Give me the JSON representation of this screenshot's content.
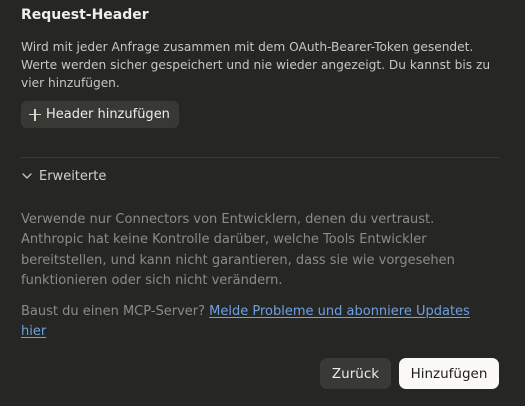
{
  "section": {
    "title": "Request-Header",
    "description": "Wird mit jeder Anfrage zusammen mit dem OAuth-Bearer-Token gesendet. Werte werden sicher gespeichert und nie wieder angezeigt. Du kannst bis zu vier hinzufügen.",
    "add_button_label": "Header hinzufügen",
    "add_button_icon": "plus-icon"
  },
  "advanced": {
    "label": "Erweiterte",
    "icon": "chevron-down-icon"
  },
  "warning_text": "Verwende nur Connectors von Entwicklern, denen du vertraust. Anthropic hat keine Kontrolle darüber, welche Tools Entwickler bereitstellen, und kann nicht garantieren, dass sie wie vorgesehen funktionieren oder sich nicht verändern.",
  "mcp": {
    "prefix": "Baust du einen MCP-Server? ",
    "link_text": "Melde Probleme und abonniere Updates hier"
  },
  "footer": {
    "back_label": "Zurück",
    "submit_label": "Hinzufügen"
  },
  "colors": {
    "background": "#262624",
    "link": "#6fa0e0",
    "primary_button": "#faf9f6"
  }
}
